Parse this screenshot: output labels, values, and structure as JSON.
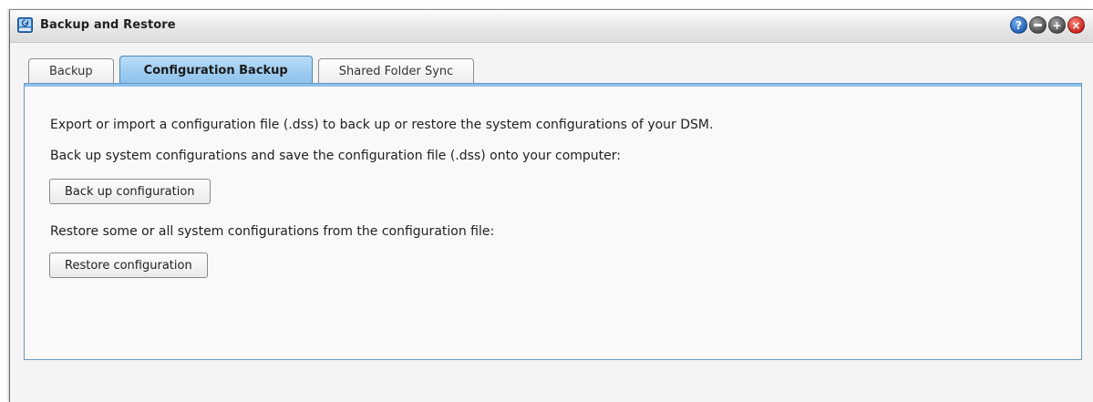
{
  "window": {
    "title": "Backup and Restore",
    "app_icon": "backup-restore-icon",
    "controls": [
      {
        "name": "help-icon",
        "glyph": "?"
      },
      {
        "name": "minimize-icon",
        "glyph": ""
      },
      {
        "name": "maximize-icon",
        "glyph": "+"
      },
      {
        "name": "close-icon",
        "glyph": "×"
      }
    ]
  },
  "tabs": [
    {
      "label": "Backup",
      "active": false
    },
    {
      "label": "Configuration Backup",
      "active": true
    },
    {
      "label": "Shared Folder Sync",
      "active": false
    }
  ],
  "content": {
    "intro": "Export or import a configuration file (.dss) to back up or restore the system configurations of your DSM.",
    "backup_desc": "Back up system configurations and save the configuration file (.dss) onto your computer:",
    "backup_button": "Back up configuration",
    "restore_desc": "Restore some or all system configurations from the configuration file:",
    "restore_button": "Restore configuration"
  },
  "colors": {
    "active_tab": "#8cc1ec",
    "panel_border": "#6b97c3",
    "close": "#c8231a",
    "help": "#1f5fb7"
  }
}
